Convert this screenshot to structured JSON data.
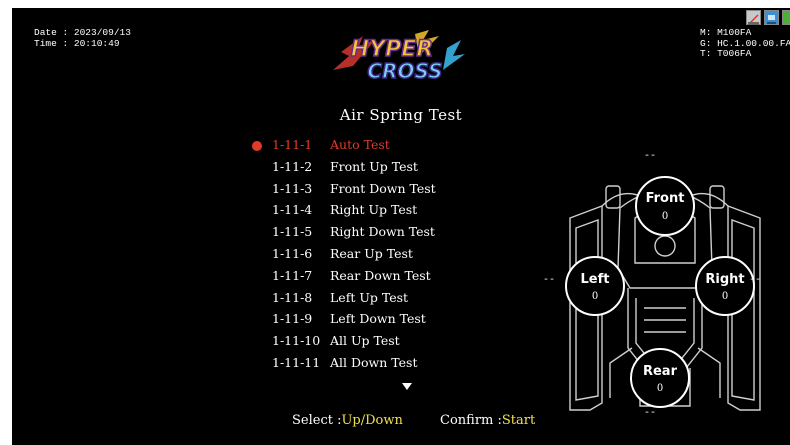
{
  "header": {
    "date_label": "Date : 2023/09/13",
    "time_label": "Time : 20:10:49",
    "machine_line": "M: M100FA",
    "game_line": "G: HC.1.00.00.FA",
    "terminal_line": "T: T006FA",
    "status_icons": [
      "can-status-icon",
      "network-status-icon",
      "power-status-icon"
    ],
    "logo_text_top": "HYPER",
    "logo_text_bottom": "CROSS"
  },
  "screen_title": "Air Spring Test",
  "menu": {
    "items": [
      {
        "code": "1-11-1",
        "label": "Auto Test",
        "selected": true
      },
      {
        "code": "1-11-2",
        "label": "Front Up Test",
        "selected": false
      },
      {
        "code": "1-11-3",
        "label": "Front Down Test",
        "selected": false
      },
      {
        "code": "1-11-4",
        "label": "Right Up Test",
        "selected": false
      },
      {
        "code": "1-11-5",
        "label": "Right Down Test",
        "selected": false
      },
      {
        "code": "1-11-6",
        "label": "Rear Up Test",
        "selected": false
      },
      {
        "code": "1-11-7",
        "label": "Rear Down Test",
        "selected": false
      },
      {
        "code": "1-11-8",
        "label": "Left Up Test",
        "selected": false
      },
      {
        "code": "1-11-9",
        "label": "Left Down Test",
        "selected": false
      },
      {
        "code": "1-11-10",
        "label": "All Up Test",
        "selected": false
      },
      {
        "code": "1-11-11",
        "label": "All Down Test",
        "selected": false
      }
    ]
  },
  "footer": {
    "select_label": "Select :",
    "select_value": "Up/Down",
    "confirm_label": "Confirm :",
    "confirm_value": "Start"
  },
  "springs": {
    "front": {
      "label": "Front",
      "value": "0",
      "dash": "--"
    },
    "left": {
      "label": "Left",
      "value": "0",
      "dash": "--"
    },
    "right": {
      "label": "Right",
      "value": "0",
      "dash": "--"
    },
    "rear": {
      "label": "Rear",
      "value": "0",
      "dash": "--"
    }
  },
  "colors": {
    "selected": "#e23a2a",
    "footer_value": "#f2e04a",
    "background": "#000000"
  }
}
